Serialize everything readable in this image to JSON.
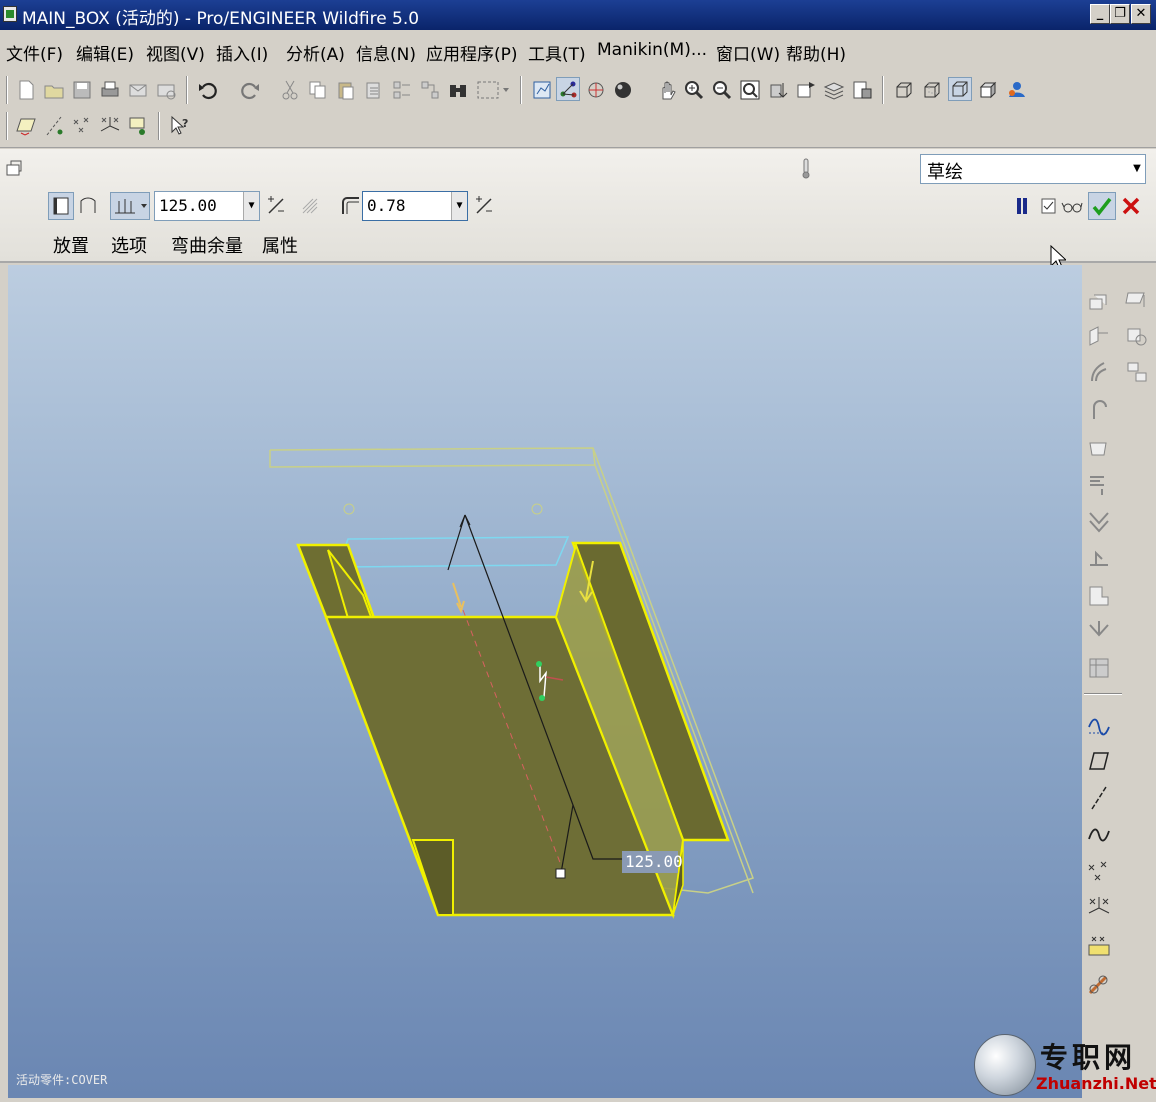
{
  "window": {
    "title": "MAIN_BOX (活动的) - Pro/ENGINEER Wildfire 5.0",
    "minimize_glyph": "_",
    "maximize_glyph": "❐",
    "close_glyph": "✕"
  },
  "menu": {
    "items": [
      {
        "label": "文件(F)"
      },
      {
        "label": "编辑(E)"
      },
      {
        "label": "视图(V)"
      },
      {
        "label": "插入(I)"
      },
      {
        "label": "分析(A)"
      },
      {
        "label": "信息(N)"
      },
      {
        "label": "应用程序(P)"
      },
      {
        "label": "工具(T)"
      },
      {
        "label": "Manikin(M)..."
      },
      {
        "label": "窗口(W)"
      },
      {
        "label": "帮助(H)"
      }
    ]
  },
  "dashboard": {
    "length_value": "125.00",
    "thickness_value": "0.78",
    "sketch_mode": "草绘",
    "tabs": [
      {
        "label": "放置"
      },
      {
        "label": "选项"
      },
      {
        "label": "弯曲余量"
      },
      {
        "label": "属性"
      }
    ],
    "dropdown_glyph": "▼",
    "confirm_color": "#1e9e1e",
    "cancel_color": "#cc1010"
  },
  "viewport": {
    "dimension_label": "125.00",
    "status_text": "活动零件:COVER",
    "model_edge_color": "#f0f000",
    "model_fill_color": "#6e6e32"
  },
  "watermark": {
    "text_cn": "专职网",
    "text_en": "Zhuanzhi.Net"
  },
  "icons": {
    "file_toolbar": [
      "new-file-icon",
      "open-file-icon",
      "save-icon",
      "print-icon",
      "email-icon",
      "email-link-icon"
    ],
    "edit_toolbar": [
      "undo-icon",
      "redo-icon",
      "cut-icon",
      "copy-icon",
      "paste-icon",
      "paste-special-icon",
      "regenerate-icon",
      "regen-manager-icon",
      "find-icon",
      "select-box-icon"
    ],
    "view_toolbar": [
      "repaint-icon",
      "spin-center-icon",
      "orient-icon",
      "appearance-icon",
      "pan-icon",
      "zoom-in-icon",
      "zoom-out-icon",
      "refit-icon",
      "reorient-icon",
      "saved-views-icon",
      "layers-icon",
      "view-manager-icon"
    ],
    "display_toolbar": [
      "wireframe-icon",
      "hidden-line-icon",
      "no-hidden-icon",
      "shading-icon",
      "model-tree-icon"
    ],
    "datum_toolbar": [
      "datum-plane-icon",
      "datum-axis-icon",
      "datum-point-icon",
      "coordinate-system-icon",
      "analysis-feature-icon"
    ],
    "help": "whats-this-icon"
  }
}
